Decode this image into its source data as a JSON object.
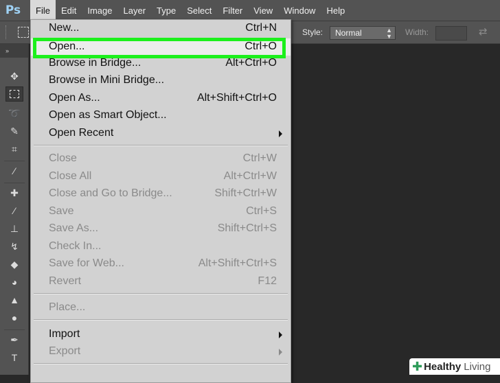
{
  "app": {
    "logo": "Ps"
  },
  "menubar": {
    "items": [
      "File",
      "Edit",
      "Image",
      "Layer",
      "Type",
      "Select",
      "Filter",
      "View",
      "Window",
      "Help"
    ],
    "active": "File"
  },
  "options": {
    "style_label": "Style:",
    "style_value": "Normal",
    "width_label": "Width:",
    "width_value": ""
  },
  "tools_header": "»",
  "file_menu": {
    "items": [
      {
        "label": "New...",
        "shortcut": "Ctrl+N"
      },
      {
        "label": "Open...",
        "shortcut": "Ctrl+O"
      },
      {
        "label": "Browse in Bridge...",
        "shortcut": "Alt+Ctrl+O"
      },
      {
        "label": "Browse in Mini Bridge...",
        "shortcut": ""
      },
      {
        "label": "Open As...",
        "shortcut": "Alt+Shift+Ctrl+O"
      },
      {
        "label": "Open as Smart Object...",
        "shortcut": ""
      },
      {
        "label": "Open Recent",
        "shortcut": ""
      },
      {
        "label": "Close",
        "shortcut": "Ctrl+W"
      },
      {
        "label": "Close All",
        "shortcut": "Alt+Ctrl+W"
      },
      {
        "label": "Close and Go to Bridge...",
        "shortcut": "Shift+Ctrl+W"
      },
      {
        "label": "Save",
        "shortcut": "Ctrl+S"
      },
      {
        "label": "Save As...",
        "shortcut": "Shift+Ctrl+S"
      },
      {
        "label": "Check In...",
        "shortcut": ""
      },
      {
        "label": "Save for Web...",
        "shortcut": "Alt+Shift+Ctrl+S"
      },
      {
        "label": "Revert",
        "shortcut": "F12"
      },
      {
        "label": "Place...",
        "shortcut": ""
      },
      {
        "label": "Import",
        "shortcut": ""
      },
      {
        "label": "Export",
        "shortcut": ""
      }
    ]
  },
  "watermark": {
    "brand_a": "Healthy",
    "brand_b": "Living"
  },
  "colors": {
    "highlight": "#1cf01c",
    "menu_bg": "#d2d2d2",
    "chrome": "#535353",
    "canvas": "#282828"
  }
}
